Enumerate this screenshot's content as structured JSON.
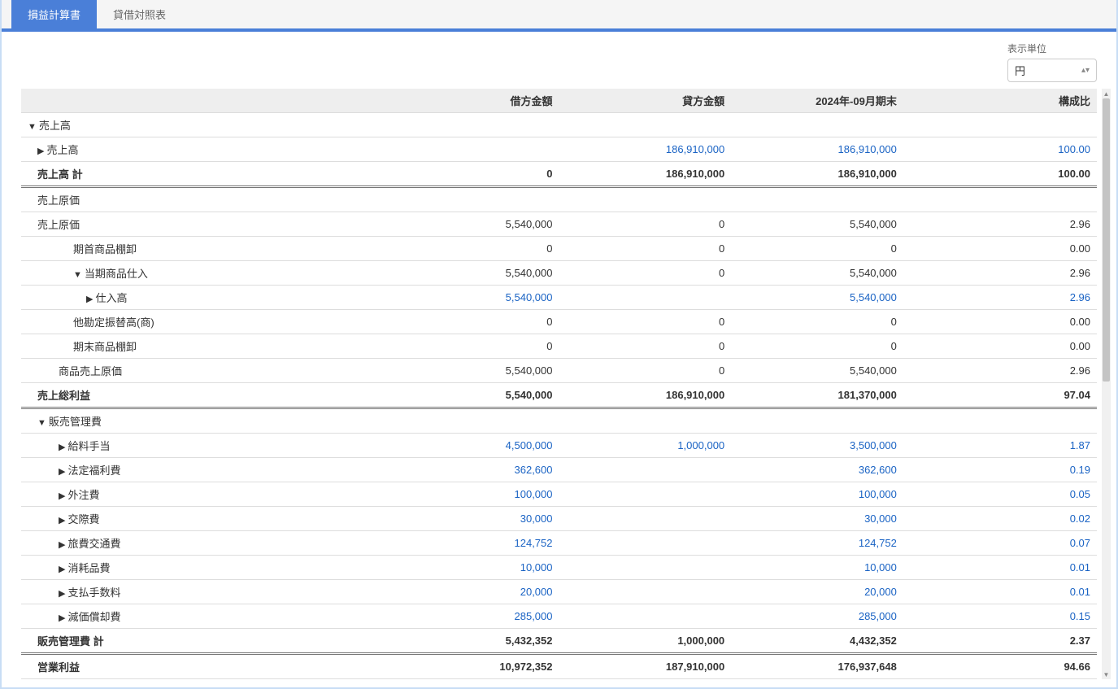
{
  "tabs": {
    "pl": "損益計算書",
    "bs": "貸借対照表"
  },
  "unit": {
    "label": "表示単位",
    "value": "円"
  },
  "header": {
    "debit": "借方金額",
    "credit": "貸方金額",
    "period": "2024年-09月期末",
    "ratio": "構成比"
  },
  "rows": [
    {
      "indent": 0,
      "expand": "down",
      "label": "売上高",
      "debit": "",
      "credit": "",
      "period": "",
      "ratio": "",
      "link": false
    },
    {
      "indent": 1,
      "expand": "right",
      "label": "売上高",
      "debit": "",
      "credit": "186,910,000",
      "period": "186,910,000",
      "ratio": "100.00",
      "link": true
    },
    {
      "indent": 1,
      "expand": "",
      "label": "売上高 計",
      "debit": "0",
      "credit": "186,910,000",
      "period": "186,910,000",
      "ratio": "100.00",
      "link": false,
      "bold": true,
      "dbl": true
    },
    {
      "indent": 1,
      "expand": "",
      "label": "売上原価",
      "debit": "",
      "credit": "",
      "period": "",
      "ratio": "",
      "link": false
    },
    {
      "indent": 1,
      "expand": "",
      "label": "売上原価",
      "debit": "5,540,000",
      "credit": "0",
      "period": "5,540,000",
      "ratio": "2.96",
      "link": false
    },
    {
      "indent": 3,
      "expand": "",
      "label": "期首商品棚卸",
      "debit": "0",
      "credit": "0",
      "period": "0",
      "ratio": "0.00",
      "link": false
    },
    {
      "indent": 3,
      "expand": "down",
      "label": "当期商品仕入",
      "debit": "5,540,000",
      "credit": "0",
      "period": "5,540,000",
      "ratio": "2.96",
      "link": false
    },
    {
      "indent": 4,
      "expand": "right",
      "label": "仕入高",
      "debit": "5,540,000",
      "credit": "",
      "period": "5,540,000",
      "ratio": "2.96",
      "link": true
    },
    {
      "indent": 3,
      "expand": "",
      "label": "他勘定振替高(商)",
      "debit": "0",
      "credit": "0",
      "period": "0",
      "ratio": "0.00",
      "link": false
    },
    {
      "indent": 3,
      "expand": "",
      "label": "期末商品棚卸",
      "debit": "0",
      "credit": "0",
      "period": "0",
      "ratio": "0.00",
      "link": false
    },
    {
      "indent": 2,
      "expand": "",
      "label": "商品売上原価",
      "debit": "5,540,000",
      "credit": "0",
      "period": "5,540,000",
      "ratio": "2.96",
      "link": false
    },
    {
      "indent": 1,
      "expand": "",
      "label": "売上総利益",
      "debit": "5,540,000",
      "credit": "186,910,000",
      "period": "181,370,000",
      "ratio": "97.04",
      "link": false,
      "bold": true,
      "dbl": true
    },
    {
      "indent": 1,
      "expand": "down",
      "label": "販売管理費",
      "debit": "",
      "credit": "",
      "period": "",
      "ratio": "",
      "link": false
    },
    {
      "indent": 2,
      "expand": "right",
      "label": "給料手当",
      "debit": "4,500,000",
      "credit": "1,000,000",
      "period": "3,500,000",
      "ratio": "1.87",
      "link": true
    },
    {
      "indent": 2,
      "expand": "right",
      "label": "法定福利費",
      "debit": "362,600",
      "credit": "",
      "period": "362,600",
      "ratio": "0.19",
      "link": true
    },
    {
      "indent": 2,
      "expand": "right",
      "label": "外注費",
      "debit": "100,000",
      "credit": "",
      "period": "100,000",
      "ratio": "0.05",
      "link": true
    },
    {
      "indent": 2,
      "expand": "right",
      "label": "交際費",
      "debit": "30,000",
      "credit": "",
      "period": "30,000",
      "ratio": "0.02",
      "link": true
    },
    {
      "indent": 2,
      "expand": "right",
      "label": "旅費交通費",
      "debit": "124,752",
      "credit": "",
      "period": "124,752",
      "ratio": "0.07",
      "link": true
    },
    {
      "indent": 2,
      "expand": "right",
      "label": "消耗品費",
      "debit": "10,000",
      "credit": "",
      "period": "10,000",
      "ratio": "0.01",
      "link": true
    },
    {
      "indent": 2,
      "expand": "right",
      "label": "支払手数料",
      "debit": "20,000",
      "credit": "",
      "period": "20,000",
      "ratio": "0.01",
      "link": true
    },
    {
      "indent": 2,
      "expand": "right",
      "label": "減価償却費",
      "debit": "285,000",
      "credit": "",
      "period": "285,000",
      "ratio": "0.15",
      "link": true
    },
    {
      "indent": 1,
      "expand": "",
      "label": "販売管理費 計",
      "debit": "5,432,352",
      "credit": "1,000,000",
      "period": "4,432,352",
      "ratio": "2.37",
      "link": false,
      "bold": true,
      "dbl": true
    },
    {
      "indent": 1,
      "expand": "",
      "label": "営業利益",
      "debit": "10,972,352",
      "credit": "187,910,000",
      "period": "176,937,648",
      "ratio": "94.66",
      "link": false,
      "bold": true
    }
  ]
}
